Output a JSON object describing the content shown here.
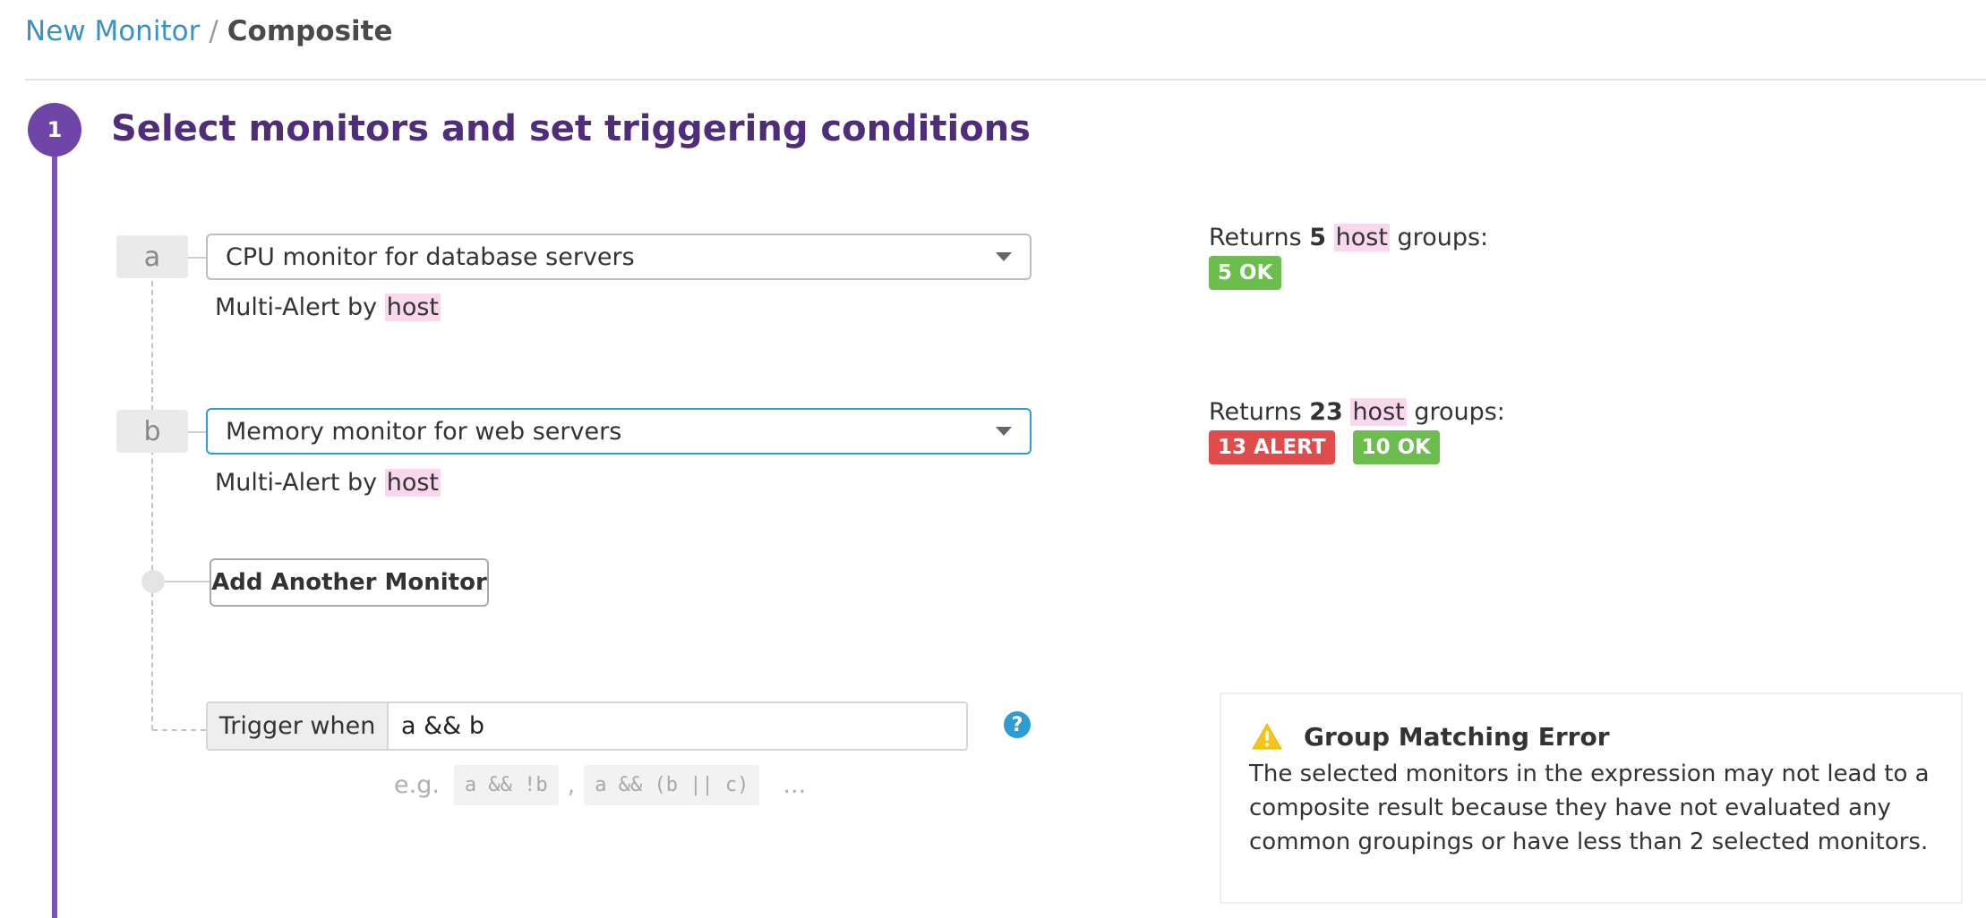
{
  "breadcrumb": {
    "parent": "New Monitor",
    "separator": "/",
    "current": "Composite"
  },
  "step": {
    "number": "1",
    "title": "Select monitors and set triggering conditions"
  },
  "monitors": [
    {
      "letter": "a",
      "selected": "CPU monitor for database servers",
      "multi_alert_prefix": "Multi-Alert by",
      "group_by": "host",
      "returns": {
        "prefix": "Returns",
        "count": "5",
        "group": "host",
        "suffix": "groups:",
        "badges": [
          {
            "label": "5 OK",
            "status": "ok"
          }
        ]
      }
    },
    {
      "letter": "b",
      "selected": "Memory monitor for web servers",
      "multi_alert_prefix": "Multi-Alert by",
      "group_by": "host",
      "returns": {
        "prefix": "Returns",
        "count": "23",
        "group": "host",
        "suffix": "groups:",
        "badges": [
          {
            "label": "13 ALERT",
            "status": "alert"
          },
          {
            "label": "10 OK",
            "status": "ok"
          }
        ]
      }
    }
  ],
  "add_monitor_label": "Add Another Monitor",
  "trigger": {
    "label": "Trigger when",
    "value": "a && b",
    "help": "?",
    "examples_prefix": "e.g.",
    "examples": [
      "a && !b",
      "a && (b || c)"
    ],
    "example_separator": ",",
    "examples_more": "..."
  },
  "error": {
    "title": "Group Matching Error",
    "message": "The selected monitors in the expression may not lead to a composite result because they have not evaluated any common groupings or have less than 2 selected monitors."
  },
  "colors": {
    "link": "#3a92c4",
    "step_purple": "#6f46a8",
    "title_purple": "#4f2d7a",
    "ok_green": "#6bbd4d",
    "alert_red": "#e04b4b",
    "warning_yellow": "#f5c518",
    "highlight_pink": "#f9d7ec",
    "focus_blue": "#2f9bd3"
  },
  "icons": [
    "chevron-down-icon",
    "question-mark-icon",
    "warning-icon"
  ]
}
